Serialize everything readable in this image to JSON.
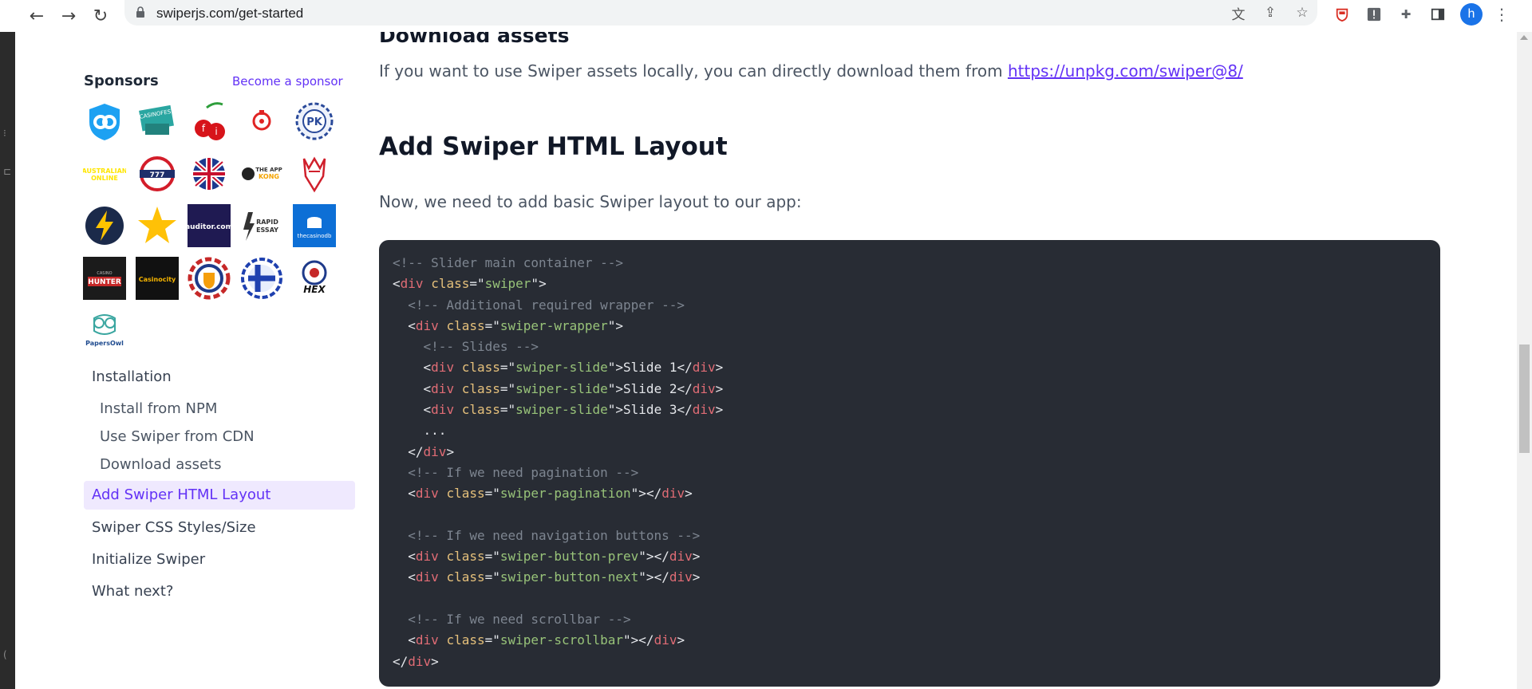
{
  "browser": {
    "url": "swiperjs.com/get-started",
    "profile_initial": "h",
    "icons": [
      "back-icon",
      "forward-icon",
      "reload-icon",
      "lock-icon",
      "translate-icon",
      "share-icon",
      "star-icon",
      "extension-shield-icon",
      "extension-info-icon",
      "puzzle-icon",
      "sidepanel-icon",
      "menu-icon"
    ]
  },
  "sidebar": {
    "sponsors_title": "Sponsors",
    "become_sponsor": "Become a sponsor",
    "sponsor_logos": [
      {
        "name": "shield-logo",
        "caption": ""
      },
      {
        "name": "casinofest-logo",
        "caption": "CASINOFEST"
      },
      {
        "name": "cherries-logo",
        "caption": ""
      },
      {
        "name": "gear-logo",
        "caption": ""
      },
      {
        "name": "chip-logo",
        "caption": ""
      },
      {
        "name": "yellow-text-logo",
        "caption": "AUSTRALIAN ONLINE"
      },
      {
        "name": "777-logo",
        "caption": "777"
      },
      {
        "name": "union-jack-logo",
        "caption": ""
      },
      {
        "name": "the-app-kong-logo",
        "caption": "THE APP KONG"
      },
      {
        "name": "red-stag-logo",
        "caption": ""
      },
      {
        "name": "lightning-logo",
        "caption": ""
      },
      {
        "name": "star-logo",
        "caption": ""
      },
      {
        "name": "casinoauditor-logo",
        "caption": "auditor.com"
      },
      {
        "name": "rapid-essay-logo",
        "caption": "RAPID ESSAY"
      },
      {
        "name": "thecasinodb-logo",
        "caption": "thecasinodb"
      },
      {
        "name": "casino-hunter-logo",
        "caption": "HUNTER"
      },
      {
        "name": "casinocity-logo",
        "caption": "Casinocity"
      },
      {
        "name": "netherlands-lion-logo",
        "caption": ""
      },
      {
        "name": "finland-cross-logo",
        "caption": ""
      },
      {
        "name": "hex-logo",
        "caption": "HEX"
      },
      {
        "name": "papersowl-logo",
        "caption": "PapersOwl"
      }
    ],
    "toc": [
      {
        "label": "Installation",
        "level": 1,
        "active": false
      },
      {
        "label": "Install from NPM",
        "level": 2,
        "active": false
      },
      {
        "label": "Use Swiper from CDN",
        "level": 2,
        "active": false
      },
      {
        "label": "Download assets",
        "level": 2,
        "active": false
      },
      {
        "label": "Add Swiper HTML Layout",
        "level": 1,
        "active": true
      },
      {
        "label": "Swiper CSS Styles/Size",
        "level": 1,
        "active": false
      },
      {
        "label": "Initialize Swiper",
        "level": 1,
        "active": false
      },
      {
        "label": "What next?",
        "level": 1,
        "active": false
      }
    ]
  },
  "main": {
    "partial_heading": "Download assets",
    "download_text": "If you want to use Swiper assets locally, you can directly download them from ",
    "download_link": "https://unpkg.com/swiper@8/",
    "section_heading": "Add Swiper HTML Layout",
    "intro_text": "Now, we need to add basic Swiper layout to our app:",
    "code_lines": [
      "<!-- Slider main container -->",
      "<div class=\"swiper\">",
      "  <!-- Additional required wrapper -->",
      "  <div class=\"swiper-wrapper\">",
      "    <!-- Slides -->",
      "    <div class=\"swiper-slide\">Slide 1</div>",
      "    <div class=\"swiper-slide\">Slide 2</div>",
      "    <div class=\"swiper-slide\">Slide 3</div>",
      "    ...",
      "  </div>",
      "  <!-- If we need pagination -->",
      "  <div class=\"swiper-pagination\"></div>",
      "",
      "  <!-- If we need navigation buttons -->",
      "  <div class=\"swiper-button-prev\"></div>",
      "  <div class=\"swiper-button-next\"></div>",
      "",
      "  <!-- If we need scrollbar -->",
      "  <div class=\"swiper-scrollbar\"></div>",
      "</div>"
    ]
  },
  "colors": {
    "accent": "#6332f6",
    "code_bg": "#282c34",
    "active_bg": "#efe9fe"
  }
}
